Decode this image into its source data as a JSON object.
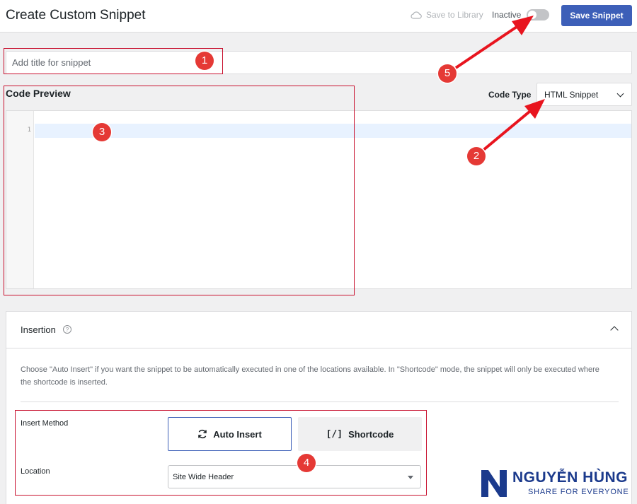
{
  "header": {
    "title": "Create Custom Snippet",
    "save_to_library": "Save to Library",
    "status_label": "Inactive",
    "save_button": "Save Snippet"
  },
  "title_field": {
    "placeholder": "Add title for snippet",
    "value": ""
  },
  "code": {
    "preview_label": "Code Preview",
    "type_label": "Code Type",
    "type_value": "HTML Snippet",
    "line_number": "1"
  },
  "insertion": {
    "title": "Insertion",
    "help": "?",
    "description": "Choose \"Auto Insert\" if you want the snippet to be automatically executed in one of the locations available. In \"Shortcode\" mode, the snippet will only be executed where the shortcode is inserted.",
    "insert_method_label": "Insert Method",
    "auto_insert": "Auto Insert",
    "shortcode_glyph": "[/]",
    "shortcode": "Shortcode",
    "location_label": "Location",
    "location_value": "Site Wide Header"
  },
  "annotations": [
    "1",
    "2",
    "3",
    "4",
    "5"
  ],
  "watermark": {
    "name": "NGUYỄN HÙNG",
    "tagline": "SHARE FOR EVERYONE"
  },
  "colors": {
    "primary": "#3d5fb8",
    "annotation": "#e53935",
    "highlight": "#c8102e",
    "brand": "#1b3a8c"
  },
  "icons": [
    "cloud-icon",
    "refresh-icon",
    "chevron-down-icon",
    "chevron-up-icon",
    "help-icon"
  ]
}
